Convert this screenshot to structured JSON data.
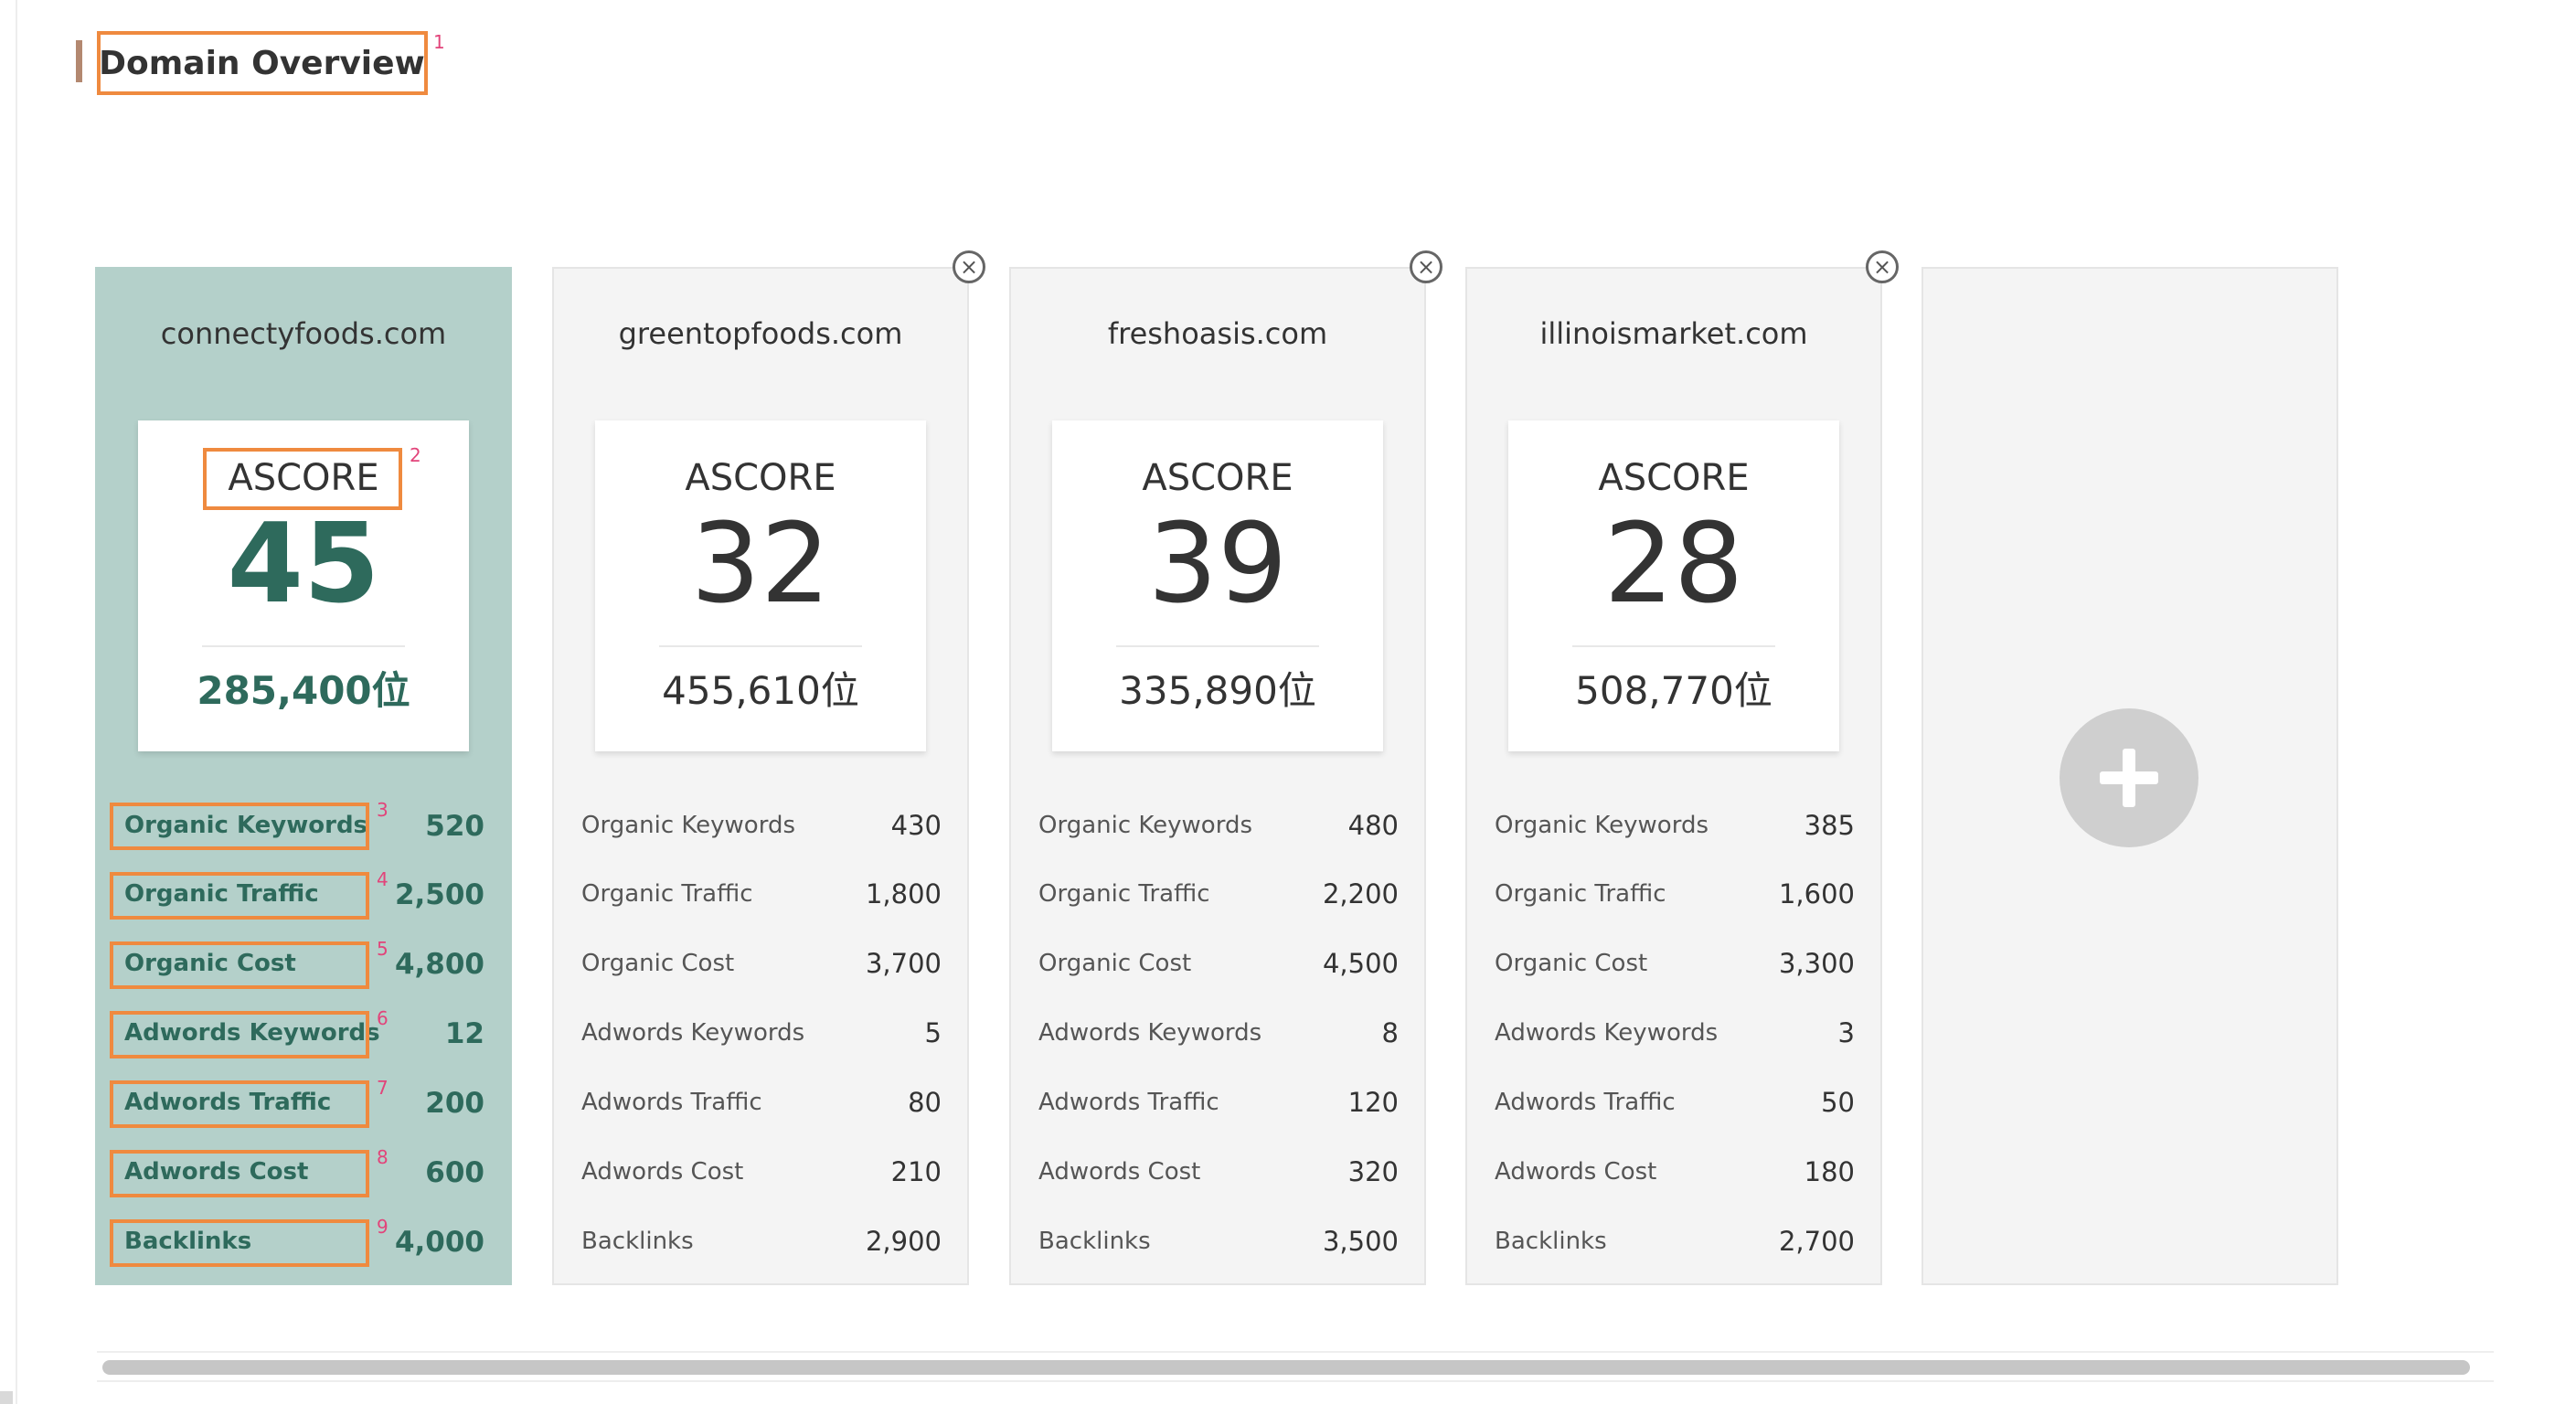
{
  "page": {
    "title": "Domain Overview"
  },
  "annotations": [
    "1",
    "2",
    "3",
    "4",
    "5",
    "6",
    "7",
    "8",
    "9"
  ],
  "cards": [
    {
      "domain": "connectyfoods.com",
      "score_label": "ASCORE",
      "score": "45",
      "rank": "285,400位",
      "metrics": [
        {
          "label": "Organic Keywords",
          "value": "520"
        },
        {
          "label": "Organic Traffic",
          "value": "2,500"
        },
        {
          "label": "Organic Cost",
          "value": "4,800"
        },
        {
          "label": "Adwords Keywords",
          "value": "12"
        },
        {
          "label": "Adwords Traffic",
          "value": "200"
        },
        {
          "label": "Adwords Cost",
          "value": "600"
        },
        {
          "label": "Backlinks",
          "value": "4,000"
        }
      ]
    },
    {
      "domain": "greentopfoods.com",
      "score_label": "ASCORE",
      "score": "32",
      "rank": "455,610位",
      "metrics": [
        {
          "label": "Organic Keywords",
          "value": "430"
        },
        {
          "label": "Organic Traffic",
          "value": "1,800"
        },
        {
          "label": "Organic Cost",
          "value": "3,700"
        },
        {
          "label": "Adwords Keywords",
          "value": "5"
        },
        {
          "label": "Adwords Traffic",
          "value": "80"
        },
        {
          "label": "Adwords Cost",
          "value": "210"
        },
        {
          "label": "Backlinks",
          "value": "2,900"
        }
      ]
    },
    {
      "domain": "freshoasis.com",
      "score_label": "ASCORE",
      "score": "39",
      "rank": "335,890位",
      "metrics": [
        {
          "label": "Organic Keywords",
          "value": "480"
        },
        {
          "label": "Organic Traffic",
          "value": "2,200"
        },
        {
          "label": "Organic Cost",
          "value": "4,500"
        },
        {
          "label": "Adwords Keywords",
          "value": "8"
        },
        {
          "label": "Adwords Traffic",
          "value": "120"
        },
        {
          "label": "Adwords Cost",
          "value": "320"
        },
        {
          "label": "Backlinks",
          "value": "3,500"
        }
      ]
    },
    {
      "domain": "illinoismarket.com",
      "score_label": "ASCORE",
      "score": "28",
      "rank": "508,770位",
      "metrics": [
        {
          "label": "Organic Keywords",
          "value": "385"
        },
        {
          "label": "Organic Traffic",
          "value": "1,600"
        },
        {
          "label": "Organic Cost",
          "value": "3,300"
        },
        {
          "label": "Adwords Keywords",
          "value": "3"
        },
        {
          "label": "Adwords Traffic",
          "value": "50"
        },
        {
          "label": "Adwords Cost",
          "value": "180"
        },
        {
          "label": "Backlinks",
          "value": "2,700"
        }
      ]
    }
  ],
  "icons": {
    "close": "close-icon",
    "add": "plus-icon"
  },
  "colors": {
    "primary_card_bg": "#b4d0ca",
    "primary_text": "#2e6a5c",
    "annotation_border": "#ef8a3f",
    "annotation_number": "#e2447a",
    "card_bg": "#f4f4f4"
  }
}
